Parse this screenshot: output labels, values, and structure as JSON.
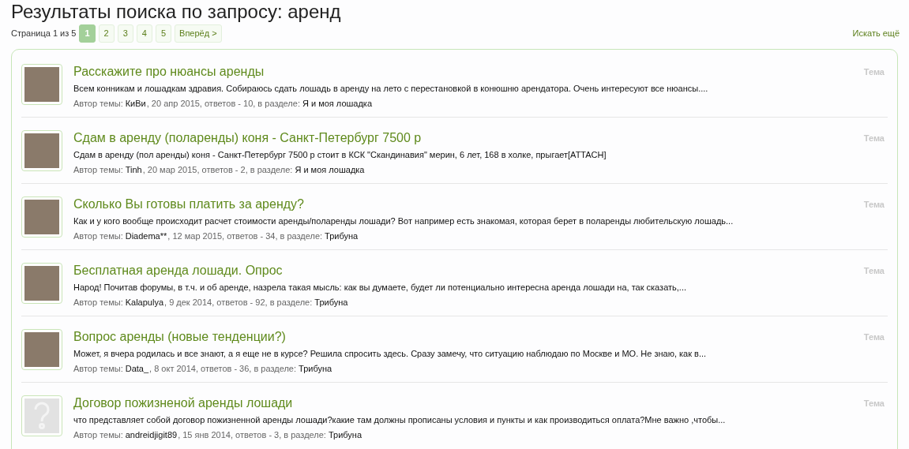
{
  "title": {
    "label": "Результаты поиска по запросу:",
    "query": "аренд"
  },
  "pagination": {
    "label": "Страница 1 из 5",
    "pages": [
      {
        "label": "1",
        "selected": true
      },
      {
        "label": "2",
        "selected": false
      },
      {
        "label": "3",
        "selected": false
      },
      {
        "label": "4",
        "selected": false
      },
      {
        "label": "5",
        "selected": false
      }
    ],
    "next": "Вперёд >"
  },
  "search_more": "Искать ещё",
  "results": [
    {
      "kind": "photo",
      "title": "Расскажите про нюансы аренды",
      "snippet": "Всем конникам и лошадкам здравия. Собираюсь сдать лошадь в аренду на лето с перестановкой в конюшню арендатора. Очень интересуют все нюансы....",
      "author_label": "Автор темы:",
      "author": "КиВи",
      "details": ", 20 апр 2015, ответов - 10, в разделе:",
      "forum": "Я и моя лошадка",
      "type": "Тема"
    },
    {
      "kind": "photo",
      "title": "Сдам в аренду (поларенды) коня - Санкт-Петербург 7500 р",
      "snippet": "Сдам в аренду (пол аренды) коня - Санкт-Петербург 7500 р стоит в КСК \"Скандинавия\" мерин, 6 лет, 168 в холке, прыгает[ATTACH]",
      "author_label": "Автор темы:",
      "author": "Tinh",
      "details": ", 20 мар 2015, ответов - 2, в разделе:",
      "forum": "Я и моя лошадка",
      "type": "Тема"
    },
    {
      "kind": "photo",
      "title": "Сколько Вы готовы платить за аренду?",
      "snippet": "Как и у кого вообще происходит расчет стоимости аренды/поларенды лошади? Вот например есть знакомая, которая берет в поларенды любительскую лошадь...",
      "author_label": "Автор темы:",
      "author": "Diadema**",
      "details": ", 12 мар 2015, ответов - 34, в разделе:",
      "forum": "Трибуна",
      "type": "Тема"
    },
    {
      "kind": "photo",
      "title": "Бесплатная аренда лошади. Опрос",
      "snippet": "Народ! Почитав форумы, в т.ч. и об аренде, назрела такая мысль: как вы думаете, будет ли потенциально интересна аренда лошади на, так сказать,...",
      "author_label": "Автор темы:",
      "author": "Kalapulya",
      "details": ", 9 дек 2014, ответов - 92, в разделе:",
      "forum": "Трибуна",
      "type": "Тема"
    },
    {
      "kind": "photo",
      "title": "Вопрос аренды (новые тенденции?)",
      "snippet": "Может, я вчера родилась и все знают, а я еще не в курсе? Решила спросить здесь. Сразу замечу, что ситуацию наблюдаю по Москве и МО. Не знаю, как в...",
      "author_label": "Автор темы:",
      "author": "Data_",
      "details": ", 8 окт 2014, ответов - 36, в разделе:",
      "forum": "Трибуна",
      "type": "Тема"
    },
    {
      "kind": "none",
      "title": "Договор пожизненой аренды лошади",
      "snippet": "что представляет собой договор пожизненной аренды лошади?какие там должны прописаны условия и пункты и как производиться оплата?Мне важно ,чтобы...",
      "author_label": "Автор темы:",
      "author": "andreidjigit89",
      "details": ", 15 янв 2014, ответов - 3, в разделе:",
      "forum": "Трибуна",
      "type": "Тема"
    }
  ]
}
